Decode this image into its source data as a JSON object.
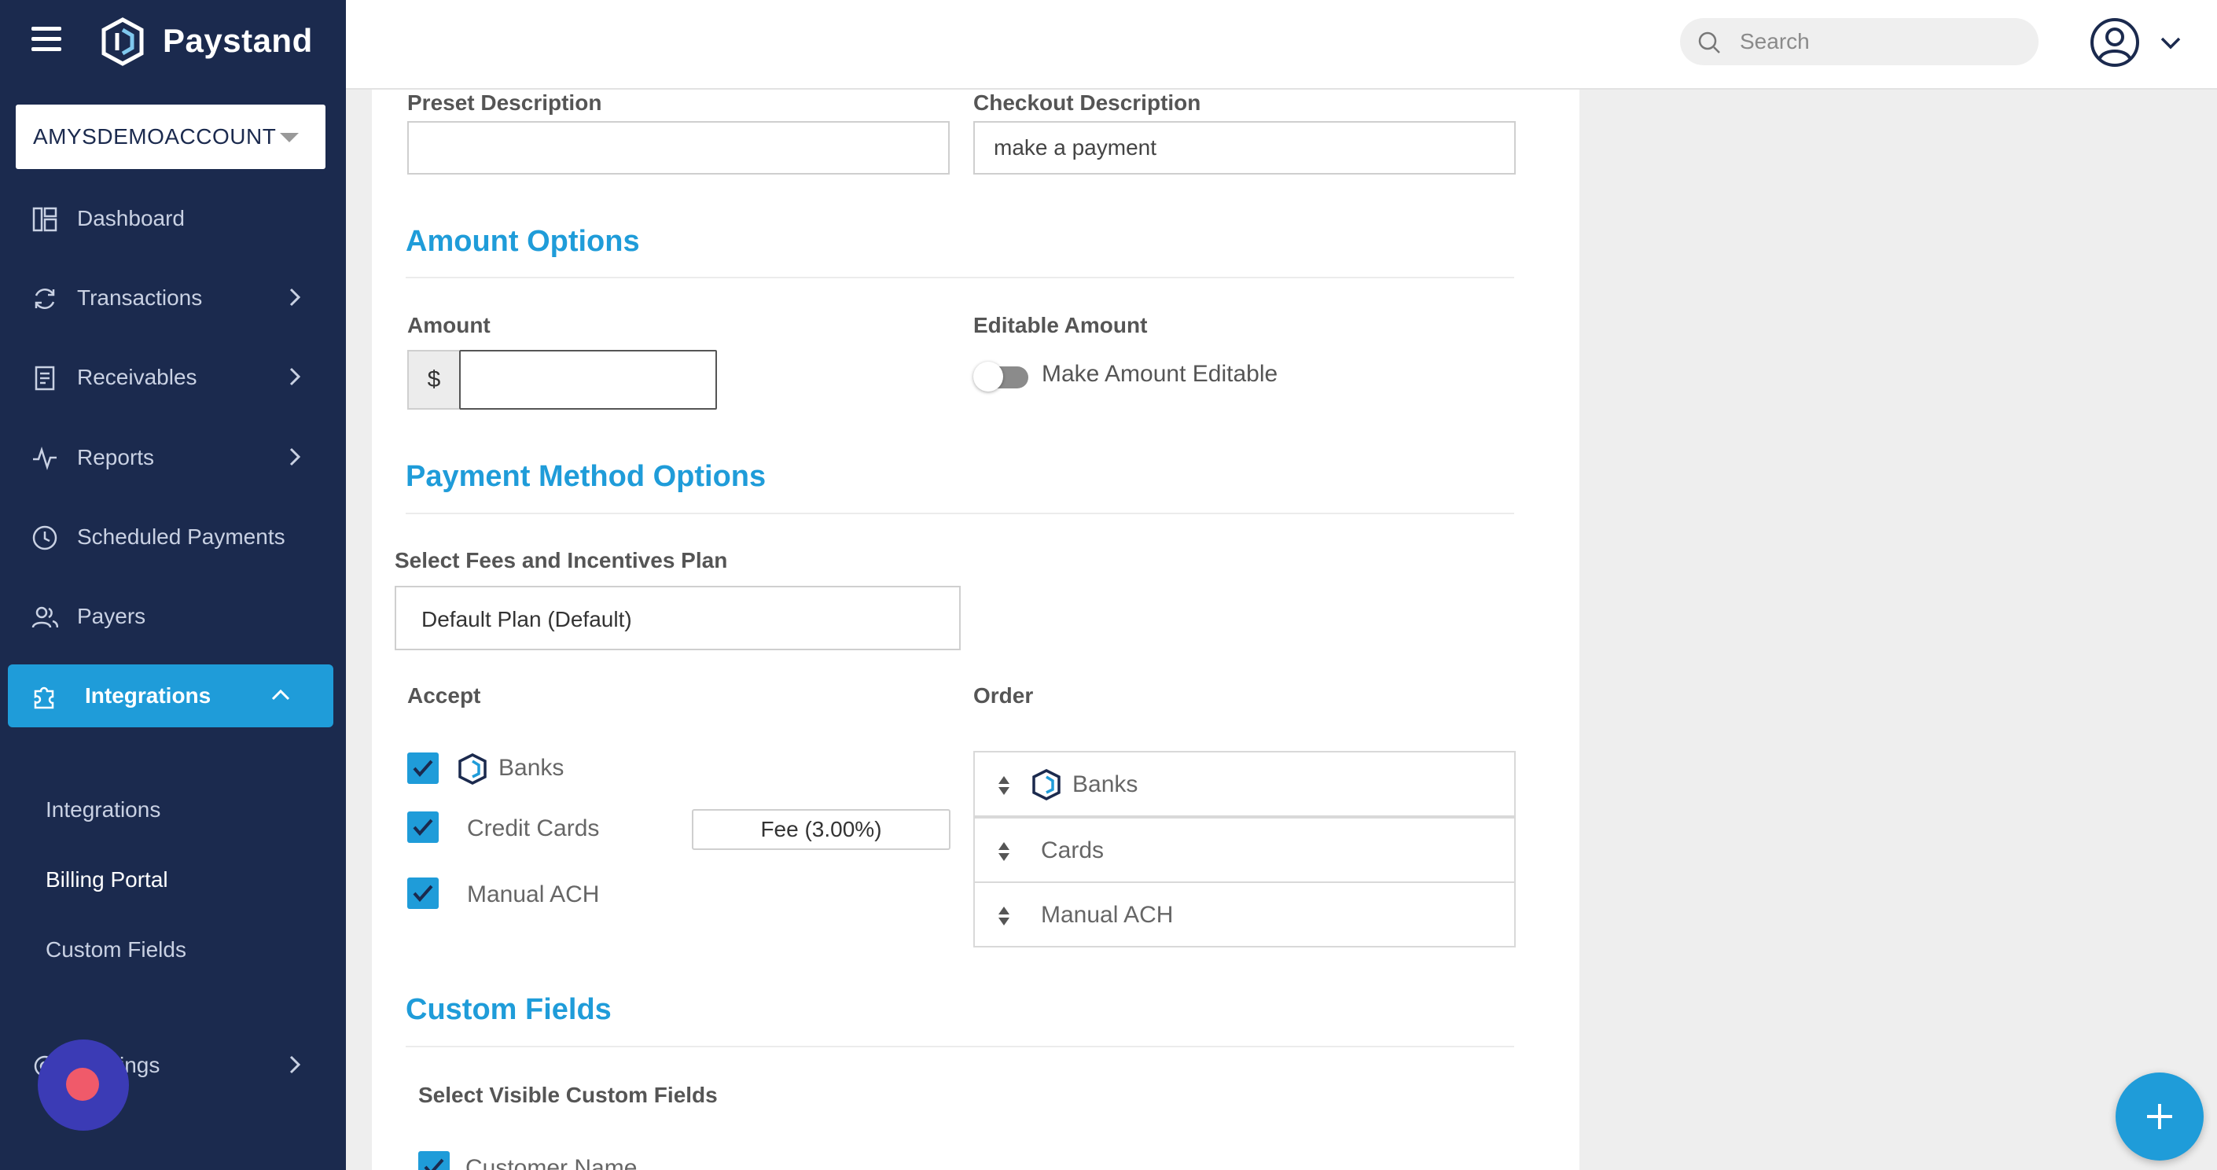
{
  "brand": {
    "name": "Paystand"
  },
  "account": {
    "selected": "AMYSDEMOACCOUNT"
  },
  "sidebar": {
    "items": [
      {
        "label": "Dashboard"
      },
      {
        "label": "Transactions"
      },
      {
        "label": "Receivables"
      },
      {
        "label": "Reports"
      },
      {
        "label": "Scheduled Payments"
      },
      {
        "label": "Payers"
      },
      {
        "label": "Integrations"
      }
    ],
    "sub_items": [
      {
        "label": "Integrations"
      },
      {
        "label": "Billing Portal"
      },
      {
        "label": "Custom Fields"
      }
    ],
    "settings_label_visible": "ings"
  },
  "topbar": {
    "search_placeholder": "Search"
  },
  "form": {
    "preset_description_label": "Preset Description",
    "preset_description_value": "",
    "checkout_description_label": "Checkout Description",
    "checkout_description_value": "make a payment",
    "amount_section_title": "Amount Options",
    "amount_label": "Amount",
    "amount_prefix": "$",
    "amount_value": "",
    "editable_amount_label": "Editable Amount",
    "editable_toggle_label": "Make Amount Editable",
    "editable_toggle_on": false,
    "payment_section_title": "Payment Method Options",
    "fees_plan_label": "Select Fees and Incentives Plan",
    "fees_plan_value": "Default Plan (Default)",
    "accept_label": "Accept",
    "order_label": "Order",
    "accept_items": [
      {
        "label": "Banks",
        "checked": true,
        "icon": "paystand-logo-icon"
      },
      {
        "label": "Credit Cards",
        "checked": true
      },
      {
        "label": "Manual ACH",
        "checked": true
      }
    ],
    "card_fee": "Fee (3.00%)",
    "order_items": [
      {
        "label": "Banks",
        "icon": "paystand-logo-icon"
      },
      {
        "label": "Cards"
      },
      {
        "label": "Manual ACH"
      }
    ],
    "custom_fields_section_title": "Custom Fields",
    "visible_custom_fields_label": "Select Visible Custom Fields",
    "custom_field_items": [
      {
        "label": "Customer Name",
        "checked": true
      }
    ]
  },
  "colors": {
    "sidebar_bg": "#1b2a4e",
    "accent": "#1f9cd9",
    "help_bubble": "#3b3bb5",
    "help_dot": "#f05a6a"
  }
}
